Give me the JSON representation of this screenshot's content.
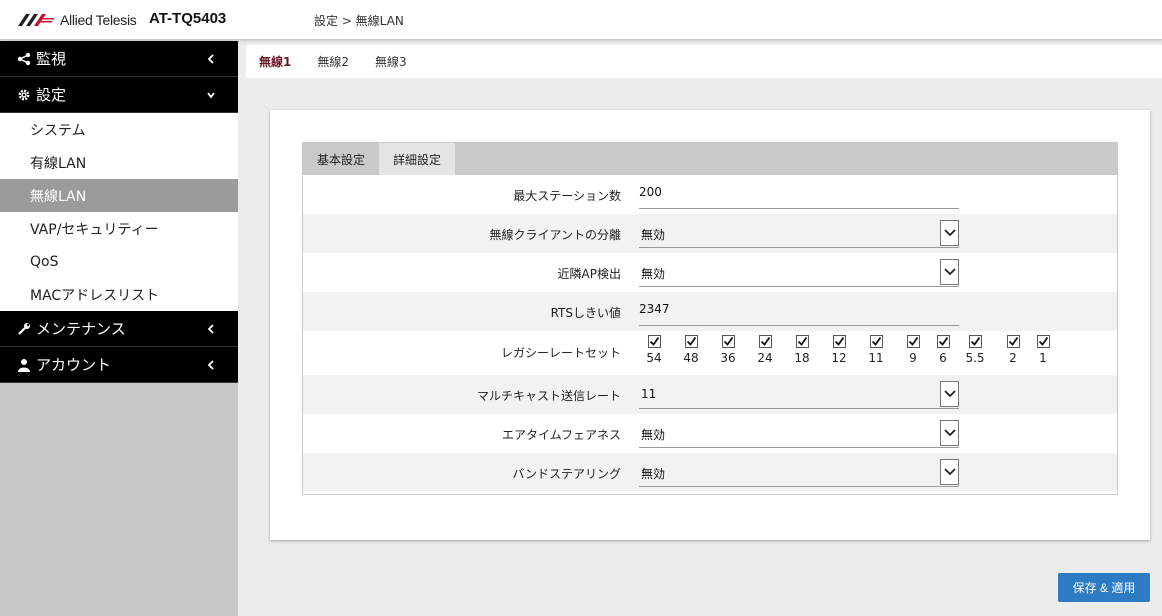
{
  "header": {
    "brand": "Allied Telesis",
    "model": "AT-TQ5403",
    "breadcrumb": "設定 > 無線LAN"
  },
  "sidebar": {
    "groups": [
      {
        "label": "監視",
        "icon": "share-icon"
      },
      {
        "label": "設定",
        "icon": "gear-icon"
      },
      {
        "label": "メンテナンス",
        "icon": "wrench-icon"
      },
      {
        "label": "アカウント",
        "icon": "user-icon"
      }
    ],
    "items": [
      {
        "label": "システム"
      },
      {
        "label": "有線LAN"
      },
      {
        "label": "無線LAN",
        "active": true
      },
      {
        "label": "VAP/セキュリティー"
      },
      {
        "label": "QoS"
      },
      {
        "label": "MACアドレスリスト"
      }
    ]
  },
  "radio_tabs": [
    "無線1",
    "無線2",
    "無線3"
  ],
  "sub_tabs": [
    "基本設定",
    "詳細設定"
  ],
  "form": {
    "max_stations": {
      "label": "最大ステーション数",
      "value": "200"
    },
    "client_isolation": {
      "label": "無線クライアントの分離",
      "value": "無効"
    },
    "neighbor_ap": {
      "label": "近隣AP検出",
      "value": "無効"
    },
    "rts": {
      "label": "RTSしきい値",
      "value": "2347"
    },
    "legacy_rates": {
      "label": "レガシーレートセット",
      "rates": [
        "54",
        "48",
        "36",
        "24",
        "18",
        "12",
        "11",
        "9",
        "6",
        "5.5",
        "2",
        "1"
      ],
      "checked": [
        true,
        true,
        true,
        true,
        true,
        true,
        true,
        true,
        true,
        true,
        true,
        true
      ]
    },
    "multicast_rate": {
      "label": "マルチキャスト送信レート",
      "value": "11"
    },
    "airtime_fairness": {
      "label": "エアタイムフェアネス",
      "value": "無効"
    },
    "band_steering": {
      "label": "バンドステアリング",
      "value": "無効"
    }
  },
  "save_button": "保存 & 適用",
  "colors": {
    "accent": "#2d7bc2",
    "active_tab": "#6a1a2a",
    "sidebar_bg": "#c8c8c8"
  }
}
